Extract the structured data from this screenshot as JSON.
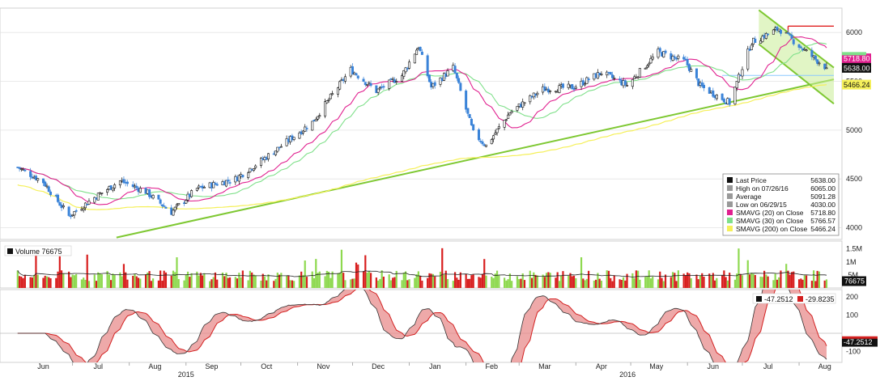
{
  "chart_data": {
    "type": "candlestick",
    "x_tick_labels": [
      "Jun",
      "Jul",
      "Aug",
      "Sep",
      "Oct",
      "Nov",
      "Dec",
      "Jan",
      "Feb",
      "Mar",
      "Apr",
      "May",
      "Jun",
      "Jul",
      "Aug"
    ],
    "year_labels": [
      "2015",
      "2016"
    ],
    "price_panel": {
      "y_ticks": [
        "6000",
        "5500",
        "5000",
        "4500",
        "4000"
      ],
      "ylim": [
        3880,
        6250
      ],
      "price_checkpoints": [
        [
          "2015-06-01",
          4620
        ],
        [
          "2015-06-15",
          4470
        ],
        [
          "2015-06-29",
          4120
        ],
        [
          "2015-07-13",
          4310
        ],
        [
          "2015-07-27",
          4480
        ],
        [
          "2015-08-10",
          4370
        ],
        [
          "2015-08-24",
          4160
        ],
        [
          "2015-09-07",
          4400
        ],
        [
          "2015-09-28",
          4500
        ],
        [
          "2015-10-19",
          4780
        ],
        [
          "2015-11-09",
          5080
        ],
        [
          "2015-11-30",
          5620
        ],
        [
          "2015-12-14",
          5400
        ],
        [
          "2015-12-28",
          5560
        ],
        [
          "2016-01-06",
          5860
        ],
        [
          "2016-01-13",
          5440
        ],
        [
          "2016-01-25",
          5640
        ],
        [
          "2016-02-05",
          4970
        ],
        [
          "2016-02-12",
          4840
        ],
        [
          "2016-02-25",
          5180
        ],
        [
          "2016-03-14",
          5420
        ],
        [
          "2016-03-31",
          5440
        ],
        [
          "2016-04-15",
          5590
        ],
        [
          "2016-04-29",
          5460
        ],
        [
          "2016-05-16",
          5800
        ],
        [
          "2016-05-31",
          5700
        ],
        [
          "2016-06-08",
          5450
        ],
        [
          "2016-06-24",
          5280
        ],
        [
          "2016-07-06",
          5900
        ],
        [
          "2016-07-21",
          6040
        ],
        [
          "2016-08-05",
          5800
        ],
        [
          "2016-08-16",
          5638
        ]
      ],
      "right_labels": [
        {
          "text": "5718.80",
          "color": "#e0208f"
        },
        {
          "text": "5638.00",
          "color": "#111111"
        },
        {
          "text": "5466.24",
          "color": "#f5f05a"
        }
      ],
      "legend": [
        {
          "label": "Last Price",
          "value": "5638.00",
          "color": "#111111"
        },
        {
          "label": "High on 07/26/16",
          "value": "6065.00",
          "color": "#999999"
        },
        {
          "label": "Average",
          "value": "5091.28",
          "color": "#999999"
        },
        {
          "label": "Low on 06/29/15",
          "value": "4030.00",
          "color": "#999999"
        },
        {
          "label": "SMAVG (20) on Close",
          "value": "5718.80",
          "color": "#e0208f"
        },
        {
          "label": "SMAVG (30) on Close",
          "value": "5766.57",
          "color": "#7fe08a"
        },
        {
          "label": "SMAVG (200) on Close",
          "value": "5466.24",
          "color": "#f5f05a"
        }
      ],
      "last_price": 5638.0,
      "high": 6065.0,
      "average": 5091.28,
      "low": 4030.0,
      "smavg_20": 5718.8,
      "smavg_30": 5766.57,
      "smavg_200": 5466.24
    },
    "volume_panel": {
      "legend_label": "Volume  76675",
      "y_ticks": [
        "1.5M",
        "1M",
        ".5M"
      ],
      "last_label": "76675",
      "ylim": [
        0,
        1800000
      ]
    },
    "indicator_panel": {
      "legend": [
        {
          "text": "-47.2512",
          "color": "#111111"
        },
        {
          "text": "-29.8235",
          "color": "#d32020"
        }
      ],
      "y_ticks": [
        "200",
        "100",
        "-100"
      ],
      "last_label": "-47.2512",
      "ylim": [
        -160,
        240
      ]
    }
  }
}
